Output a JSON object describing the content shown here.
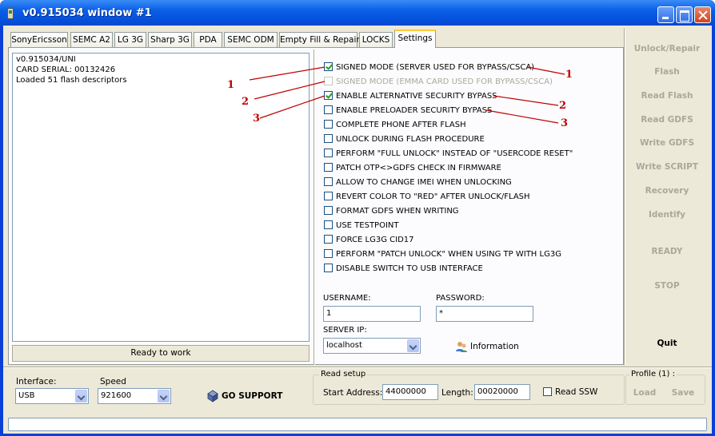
{
  "window": {
    "title": "v0.915034 window #1"
  },
  "tabs": [
    {
      "label": "SonyEricsson"
    },
    {
      "label": "SEMC A2"
    },
    {
      "label": "LG 3G"
    },
    {
      "label": "Sharp 3G"
    },
    {
      "label": "PDA"
    },
    {
      "label": "SEMC ODM"
    },
    {
      "label": "Empty Fill & Repair"
    },
    {
      "label": "LOCKS"
    },
    {
      "label": "Settings"
    }
  ],
  "log": {
    "lines": [
      "v0.915034/UNI",
      "CARD SERIAL: 00132426",
      "Loaded 51 flash descriptors"
    ]
  },
  "status_panel": {
    "text": "Ready to work"
  },
  "options": [
    {
      "label": "SIGNED MODE (SERVER USED FOR BYPASS/CSCA)",
      "checked": true,
      "enabled": true
    },
    {
      "label": "SIGNED MODE (EMMA CARD USED FOR BYPASS/CSCA)",
      "checked": false,
      "enabled": false
    },
    {
      "label": "ENABLE ALTERNATIVE SECURITY BYPASS",
      "checked": true,
      "enabled": true
    },
    {
      "label": "ENABLE PRELOADER SECURITY BYPASS",
      "checked": false,
      "enabled": true
    },
    {
      "label": "COMPLETE PHONE AFTER FLASH",
      "checked": false,
      "enabled": true
    },
    {
      "label": "UNLOCK DURING FLASH PROCEDURE",
      "checked": false,
      "enabled": true
    },
    {
      "label": "PERFORM \"FULL UNLOCK\" INSTEAD OF \"USERCODE RESET\"",
      "checked": false,
      "enabled": true
    },
    {
      "label": "PATCH OTP<>GDFS CHECK IN FIRMWARE",
      "checked": false,
      "enabled": true
    },
    {
      "label": "ALLOW TO CHANGE IMEI WHEN UNLOCKING",
      "checked": false,
      "enabled": true
    },
    {
      "label": "REVERT COLOR TO \"RED\" AFTER UNLOCK/FLASH",
      "checked": false,
      "enabled": true
    },
    {
      "label": "FORMAT GDFS WHEN WRITING",
      "checked": false,
      "enabled": true
    },
    {
      "label": "USE TESTPOINT",
      "checked": false,
      "enabled": true
    },
    {
      "label": "FORCE LG3G CID17",
      "checked": false,
      "enabled": true
    },
    {
      "label": "PERFORM \"PATCH UNLOCK\" WHEN USING TP WITH LG3G",
      "checked": false,
      "enabled": true
    },
    {
      "label": "DISABLE SWITCH TO USB INTERFACE",
      "checked": false,
      "enabled": true
    }
  ],
  "credentials": {
    "username_label": "USERNAME:",
    "username_value": "1",
    "password_label": "PASSWORD:",
    "password_value": "*",
    "server_label": "SERVER IP:",
    "server_value": "localhost",
    "info_label": "Information"
  },
  "side_buttons": [
    {
      "label": "Unlock/Repair",
      "enabled": false
    },
    {
      "label": "Flash",
      "enabled": false
    },
    {
      "label": "Read Flash",
      "enabled": false
    },
    {
      "label": "Read GDFS",
      "enabled": false
    },
    {
      "label": "Write GDFS",
      "enabled": false
    },
    {
      "label": "Write SCRIPT",
      "enabled": false
    },
    {
      "label": "Recovery",
      "enabled": false
    },
    {
      "label": "Identify",
      "enabled": false
    },
    {
      "label": "READY",
      "enabled": false
    },
    {
      "label": "STOP",
      "enabled": false
    },
    {
      "label": "Quit",
      "enabled": true
    }
  ],
  "bottom": {
    "interface_label": "Interface:",
    "interface_value": "USB",
    "speed_label": "Speed",
    "speed_value": "921600",
    "go_support": "GO SUPPORT",
    "read_setup_title": "Read setup",
    "start_address_label": "Start Address:",
    "start_address_value": "44000000",
    "length_label": "Length:",
    "length_value": "00020000",
    "read_ssw_label": "Read SSW",
    "profile_title": "Profile (1) :",
    "load_label": "Load",
    "save_label": "Save"
  },
  "annotations": {
    "left": [
      "1",
      "2",
      "3"
    ],
    "right": [
      "1",
      "2",
      "3"
    ],
    "color": "#c00000"
  },
  "colors": {
    "titlebar": "#0550dc",
    "face": "#ece9d8",
    "tab_highlight": "#ffc83c",
    "check": "#21a121",
    "disabled_text": "#aca899"
  }
}
